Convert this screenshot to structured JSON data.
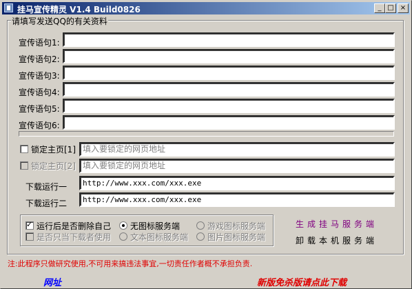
{
  "window": {
    "title": "挂马宣传精灵 V1.4 Build0826",
    "min_label": "_",
    "max_label": "□",
    "close_label": "×"
  },
  "qq_group": {
    "legend": "请填写发送QQ的有关资料",
    "slogans": [
      {
        "label": "宣传语句1:",
        "value": ""
      },
      {
        "label": "宣传语句2:",
        "value": ""
      },
      {
        "label": "宣传语句3:",
        "value": ""
      },
      {
        "label": "宣传语句4:",
        "value": ""
      },
      {
        "label": "宣传语句5:",
        "value": ""
      },
      {
        "label": "宣传语句6:",
        "value": ""
      }
    ],
    "progress": 0
  },
  "homepage": {
    "lock1": {
      "label": "锁定主页[1]",
      "checked": false,
      "enabled": true,
      "placeholder": "填入要锁定的网页地址"
    },
    "lock2": {
      "label": "锁定主页[2]",
      "checked": false,
      "enabled": false,
      "placeholder": "填入要锁定的网页地址"
    }
  },
  "downloads": {
    "run1": {
      "label": "下载运行一",
      "value": "http://www.xxx.com/xxx.exe"
    },
    "run2": {
      "label": "下载运行二",
      "value": "http://www.xxx.com/xxx.exe"
    }
  },
  "options": {
    "delete_self": {
      "label": "运行后是否删除自己",
      "checked": true
    },
    "only_downloader": {
      "label": "是否只当下载者使用",
      "checked": false,
      "enabled": false
    },
    "no_icon": {
      "label": "无图标服务端",
      "selected": true
    },
    "game_icon": {
      "label": "游戏图标服务端",
      "enabled": false
    },
    "text_icon": {
      "label": "文本图标服务端",
      "enabled": false
    },
    "image_icon": {
      "label": "图片图标服务端",
      "enabled": false
    }
  },
  "actions": {
    "generate": "生成挂马服务端",
    "uninstall": "卸载本机服务端"
  },
  "footer": {
    "note": "注:此程序只做研究使用,不可用来搞违法事宜,一切责任作者概不承担负责.",
    "website": "网址",
    "download_new": "新版免杀版请点此下载"
  },
  "colors": {
    "generate": "#800080",
    "note": "#e00000",
    "website": "#0000ff",
    "download_new": "#e00000"
  }
}
